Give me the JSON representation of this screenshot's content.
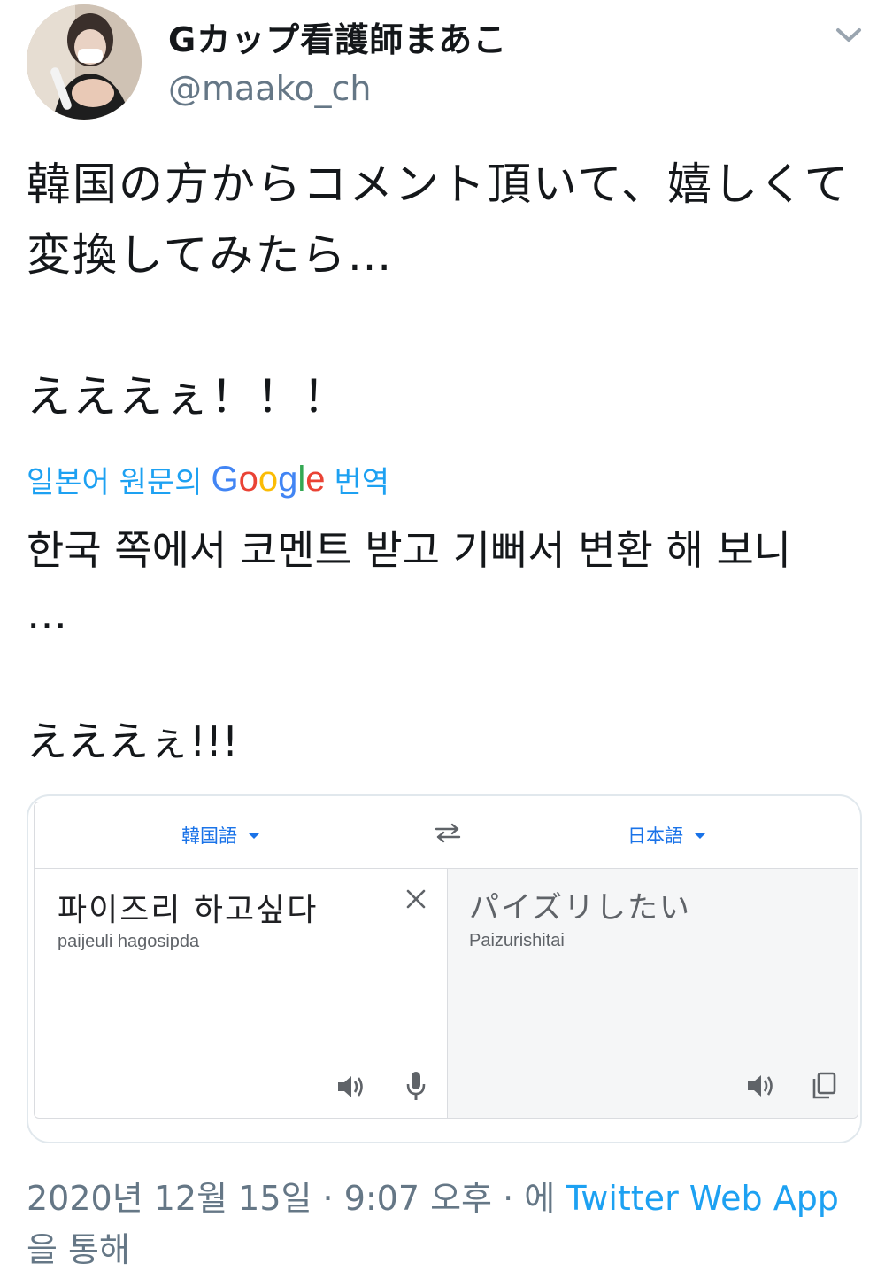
{
  "user": {
    "display_name": "Gカップ看護師まあこ",
    "handle": "@maako_ch"
  },
  "icons": {
    "avatar": "profile-photo",
    "menu": "chevron-down-icon",
    "swap": "swap-arrows-icon",
    "clear": "close-icon",
    "speaker": "speaker-icon",
    "mic": "microphone-icon",
    "copy": "copy-icon"
  },
  "tweet": {
    "text": "韓国の方からコメント頂いて、嬉しくて変換してみたら…\n\nえええぇ！！！",
    "translate_label_pre": "일본어 원문의",
    "translate_label_google": "Google",
    "translate_label_post": "번역",
    "translated_text": "한국 쪽에서 코멘트 받고 기뻐서 변환 해 보니\n…\n\nえええぇ!!!"
  },
  "translate_card": {
    "source_lang": "韓国語",
    "target_lang": "日本語",
    "source_text": "파이즈리 하고싶다",
    "source_romanization": "paijeuli hagosipda",
    "target_text": "パイズリしたい",
    "target_romanization": "Paizurishitai"
  },
  "meta": {
    "timestamp": "2020년 12월 15일 · 9:07 오후 · 에",
    "app_name": "Twitter Web App",
    "via_suffix": "을 통해"
  },
  "colors": {
    "link": "#1da1f2",
    "google_blue": "#4285f4",
    "google_red": "#ea4335",
    "google_yellow": "#fbbc05",
    "google_green": "#34a853",
    "gt_accent": "#1a73e8"
  }
}
